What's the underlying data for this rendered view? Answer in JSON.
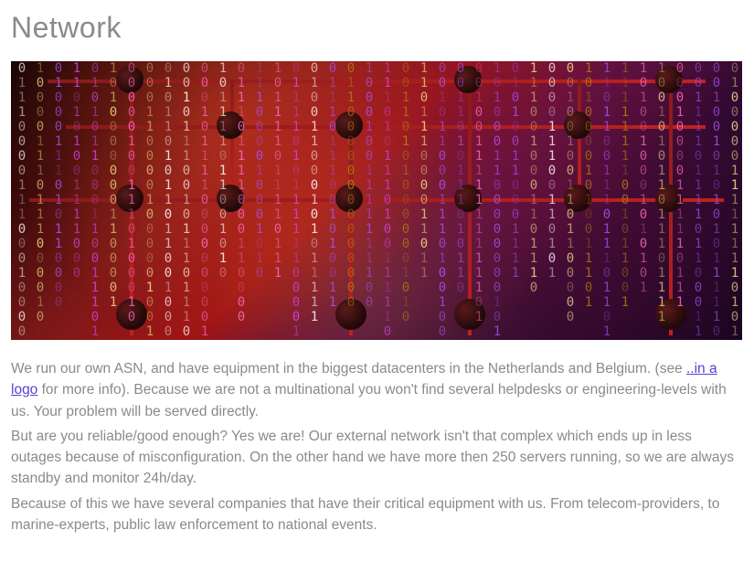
{
  "title": "Network",
  "hero_alt": "binary-network",
  "paragraph1_before": "We run our own ASN, and have equipment in the biggest datacenters in the Netherlands and Belgium. (see ",
  "link_text": "..in a logo",
  "paragraph1_after": " for more info). Because we are not a multinational you won't find several helpdesks or engineering-levels with us. Your problem will be served directly.",
  "paragraph2": "But are you reliable/good enough? Yes we are! Our external network isn't that complex which ends up in less outages because of misconfiguration. On the other hand we have more then 250 servers running, so we are always standby and monitor 24h/day.",
  "paragraph3": "Because of this we have several companies that have their critical equipment with us. From telecom-providers, to marine-experts, public law enforcement to national events."
}
